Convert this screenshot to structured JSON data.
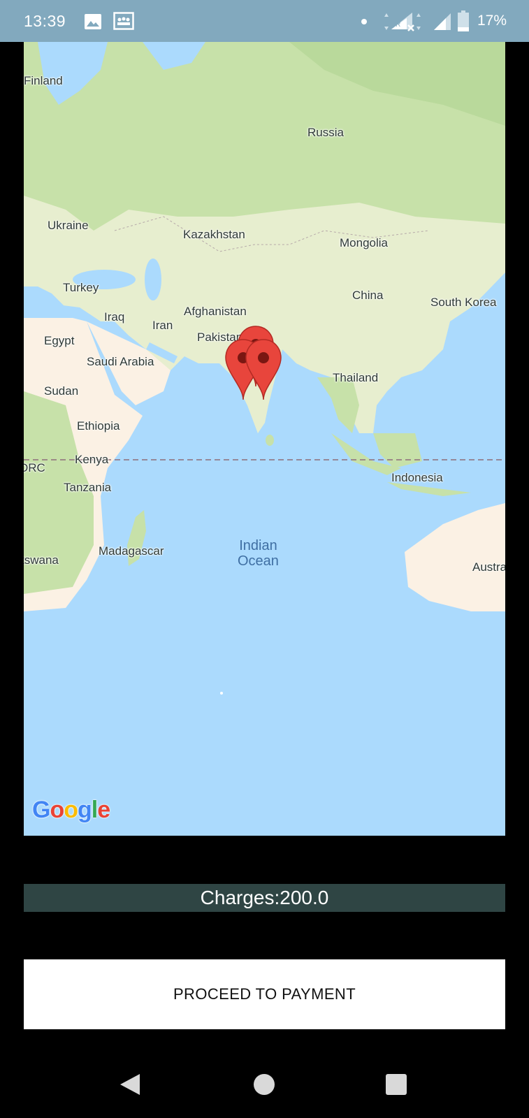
{
  "status_bar": {
    "time": "13:39",
    "battery_percent": "17%",
    "icons": [
      "image-icon",
      "notification-icon",
      "dot-icon",
      "signal-roaming-icon",
      "signal-icon",
      "battery-icon"
    ],
    "background": "#82a9be"
  },
  "map": {
    "labels": {
      "finland": "Finland",
      "russia": "Russia",
      "ukraine": "Ukraine",
      "kazakhstan": "Kazakhstan",
      "mongolia": "Mongolia",
      "turkey": "Turkey",
      "china": "China",
      "south_korea": "South Korea",
      "iraq": "Iraq",
      "afghanistan": "Afghanistan",
      "iran": "Iran",
      "egypt": "Egypt",
      "pakistan": "Pakistan",
      "saudi_arabia": "Saudi Arabia",
      "sudan": "Sudan",
      "thailand": "Thailand",
      "ethiopia": "Ethiopia",
      "kenya": "Kenya",
      "drc": "DRC",
      "tanzania": "Tanzania",
      "indonesia": "Indonesia",
      "madagascar": "Madagascar",
      "botswana": "tswana",
      "australia": "Austra",
      "indian_ocean_line1": "Indian",
      "indian_ocean_line2": "Ocean"
    },
    "logo": "Google",
    "marker_color": "#e8453c",
    "markers_count": 3
  },
  "charges": {
    "label": "Charges:200.0"
  },
  "actions": {
    "proceed_label": "PROCEED TO PAYMENT"
  },
  "nav_bar": {
    "icons": [
      "back-icon",
      "home-icon",
      "recents-icon"
    ]
  }
}
